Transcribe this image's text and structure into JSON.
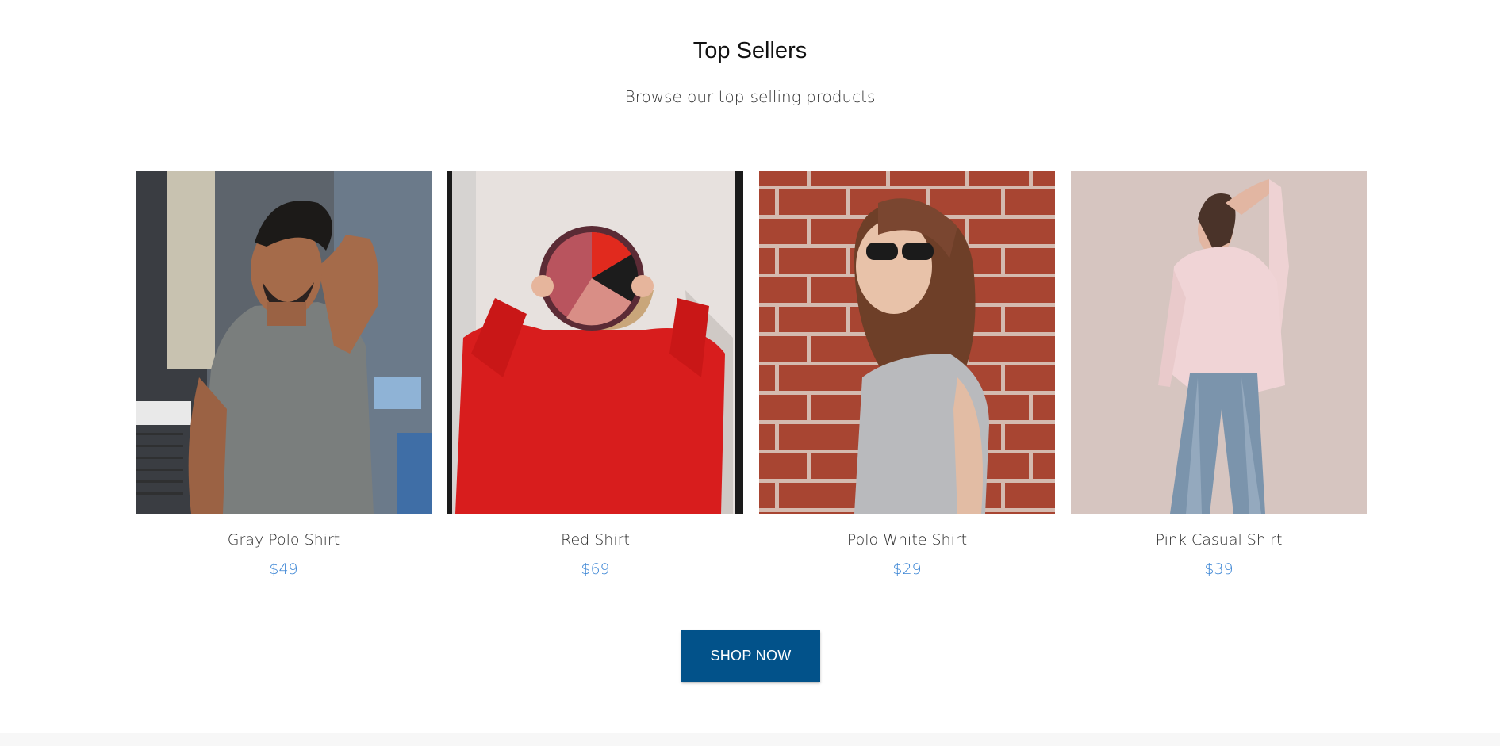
{
  "section": {
    "title": "Top Sellers",
    "subtitle": "Browse our top-selling products"
  },
  "products": [
    {
      "name": "Gray Polo Shirt",
      "price": "$49",
      "image_icon": "man-gray-tshirt-photo"
    },
    {
      "name": "Red Shirt",
      "price": "$69",
      "image_icon": "woman-red-shirt-photo"
    },
    {
      "name": "Polo White Shirt",
      "price": "$29",
      "image_icon": "woman-white-tshirt-brick-wall-photo"
    },
    {
      "name": "Pink Casual Shirt",
      "price": "$39",
      "image_icon": "woman-pink-shirt-jeans-photo"
    }
  ],
  "cta": {
    "label": "SHOP NOW"
  },
  "colors": {
    "price": "#3a84d4",
    "button": "#02528a",
    "title": "#111111"
  }
}
